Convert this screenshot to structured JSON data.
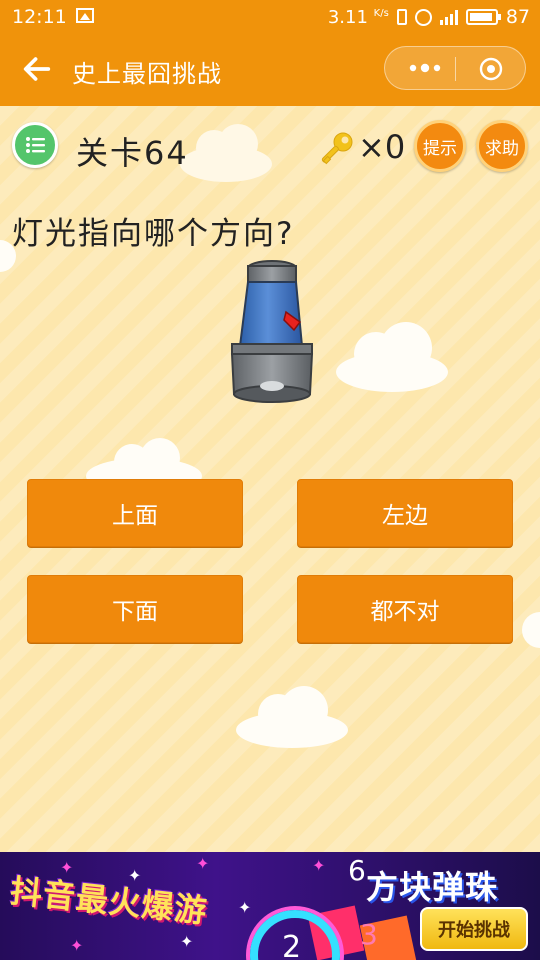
{
  "status_bar": {
    "time": "12:11",
    "network_speed": "3.11",
    "network_unit": "K/s",
    "battery": "87"
  },
  "nav": {
    "title": "史上最囧挑战",
    "back_icon": "arrow-left-icon",
    "more_icon": "more-dots-icon",
    "close_icon": "target-circle-icon"
  },
  "game": {
    "level_label": "关卡64",
    "key_count": "×0",
    "hint_label": "提示",
    "help_label": "求助",
    "question": "灯光指向哪个方向?",
    "answers": [
      "上面",
      "左边",
      "下面",
      "都不对"
    ]
  },
  "banner": {
    "left_text": "抖音最火爆游",
    "title": "方块弹珠",
    "button": "开始挑战",
    "num_ring": "2",
    "num_top": "6",
    "num_bottom": "3"
  },
  "colors": {
    "accent": "#f0930b",
    "answer_bg": "#f0890c",
    "background": "#fde7ad",
    "menu_green": "#54c56b"
  }
}
